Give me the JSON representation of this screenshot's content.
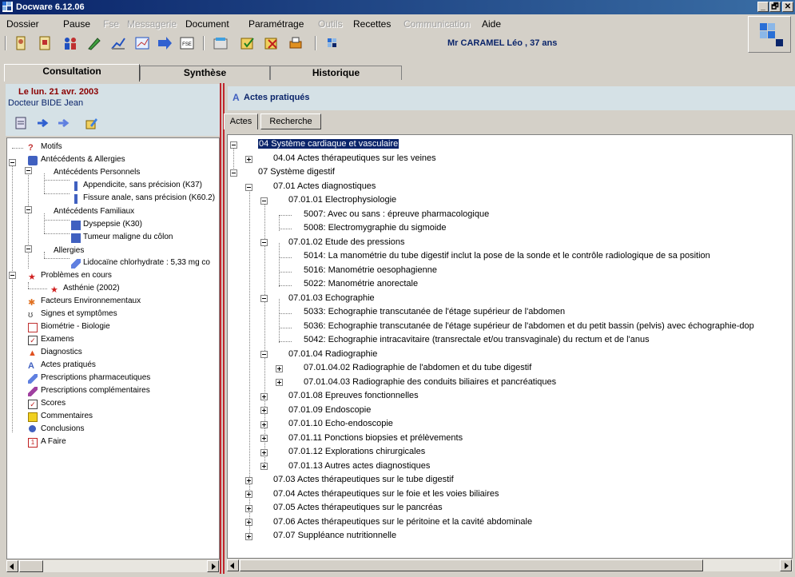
{
  "window": {
    "title": "Docware 6.12.06",
    "buttons": [
      "_",
      "🗗",
      "✕"
    ]
  },
  "menu": [
    {
      "label": "Dossier",
      "enabled": true
    },
    {
      "label": "Pause",
      "enabled": true
    },
    {
      "label": "Fse",
      "enabled": false
    },
    {
      "label": "Messagerie",
      "enabled": false
    },
    {
      "label": "Document",
      "enabled": true
    },
    {
      "label": "Paramétrage",
      "enabled": true
    },
    {
      "label": "Outils",
      "enabled": false
    },
    {
      "label": "Recettes",
      "enabled": true
    },
    {
      "label": "Communication",
      "enabled": false
    },
    {
      "label": "Aide",
      "enabled": true
    }
  ],
  "toolbar": {
    "fse_label": "FSE",
    "patient": "Mr CARAMEL Léo , 37 ans"
  },
  "tabs": [
    "Consultation",
    "Synthèse",
    "Historique"
  ],
  "left": {
    "date": "Le lun. 21 avr. 2003",
    "doctor": "Docteur BIDE Jean",
    "tree": [
      "Motifs",
      "Antécédents & Allergies",
      "Antécédents Personnels",
      "Appendicite, sans précision (K37)",
      "Fissure anale, sans précision (K60.2)",
      "Antécédents Familiaux",
      "Dyspepsie (K30)",
      "Tumeur maligne du côlon",
      "Allergies",
      "Lidocaïne chlorhydrate : 5,33 mg co",
      "Problèmes en cours",
      "Asthénie (2002)",
      "Facteurs Environnementaux",
      "Signes et symptômes",
      "Biométrie - Biologie",
      "Examens",
      "Diagnostics",
      "Actes pratiqués",
      "Prescriptions pharmaceutiques",
      "Prescriptions complémentaires",
      "Scores",
      "Commentaires",
      "Conclusions",
      "A Faire"
    ]
  },
  "right": {
    "title": "Actes pratiqués",
    "subtabs": [
      "Actes",
      "Recherche"
    ],
    "tree": [
      "04 Système cardiaque et vasculaire",
      "04.04 Actes thérapeutiques sur les veines",
      "07 Système digestif",
      "07.01 Actes diagnostiques",
      "07.01.01 Electrophysiologie",
      "5007: Avec ou sans : épreuve pharmacologique",
      "5008: Electromygraphie du sigmoide",
      "07.01.02 Etude des pressions",
      "5014: La manométrie du tube digestif inclut la pose de la sonde et le contrôle radiologique de sa position",
      "5016: Manométrie oesophagienne",
      "5022: Manométrie anorectale",
      "07.01.03 Echographie",
      "5033: Echographie transcutanée de l'étage supérieur de l'abdomen",
      "5036: Echographie transcutanée de l'étage supérieur de l'abdomen et du petit bassin (pelvis) avec échographie-dop",
      "5042: Echographie intracavitaire (transrectale et/ou transvaginale) du rectum et de l'anus",
      "07.01.04 Radiographie",
      "07.01.04.02 Radiographie de l'abdomen et du tube digestif",
      "07.01.04.03 Radiographie des conduits biliaires et pancréatiques",
      "07.01.08 Epreuves fonctionnelles",
      "07.01.09 Endoscopie",
      "07.01.10 Echo-endoscopie",
      "07.01.11 Ponctions biopsies et prélèvements",
      "07.01.12 Explorations chirurgicales",
      "07.01.13 Autres actes diagnostiques",
      "07.03 Actes thérapeutiques sur le tube digestif",
      "07.04 Actes thérapeutiques sur le foie et les voies biliaires",
      "07.05 Actes thérapeutiques sur le pancréas",
      "07.06 Actes thérapeutiques sur le péritoine et la cavité abdominale",
      "07.07 Suppléance nutritionnelle"
    ]
  }
}
